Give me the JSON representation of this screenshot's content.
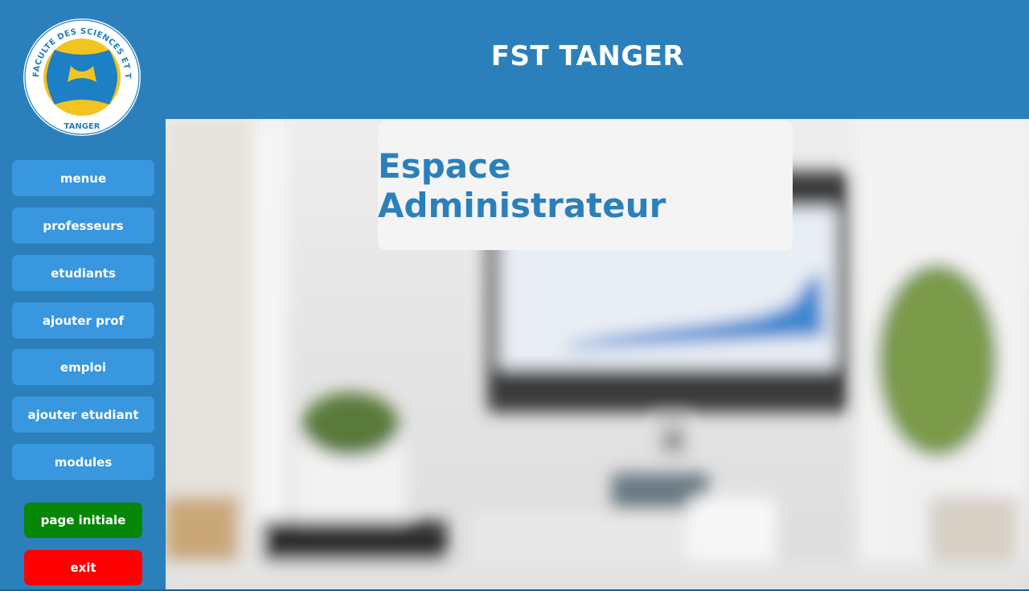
{
  "window": {
    "header_title": "FST TANGER"
  },
  "logo": {
    "text_top": "FACULTE DES SCIENCES ET TECHNIQUES",
    "text_bottom": "TANGER"
  },
  "sidebar": {
    "items": [
      {
        "label": "menue"
      },
      {
        "label": "professeurs"
      },
      {
        "label": "etudiants"
      },
      {
        "label": "ajouter prof"
      },
      {
        "label": "emploi"
      },
      {
        "label": "ajouter etudiant"
      },
      {
        "label": "modules"
      }
    ],
    "actions": {
      "home_label": "page initiale",
      "exit_label": "exit"
    }
  },
  "main": {
    "card_title": "Espace Administrateur"
  },
  "colors": {
    "primary": "#2b80bb",
    "nav_button": "#3897de",
    "home_button": "#078707",
    "exit_button": "#fe0000",
    "logo_yellow": "#f3c31f",
    "logo_blue": "#1d7fc4"
  }
}
